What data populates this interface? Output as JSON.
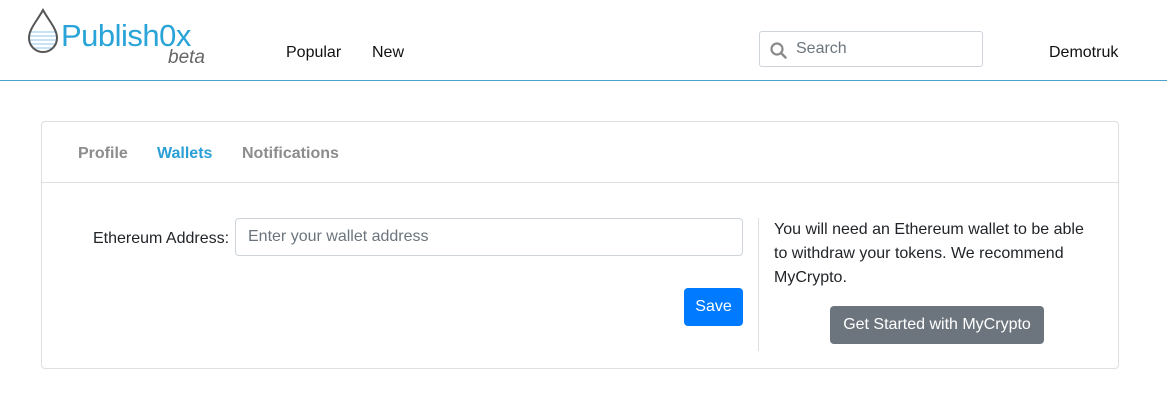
{
  "brand": {
    "name": "Publish0x",
    "badge": "beta",
    "logo_icon": "droplet-logo-icon",
    "accent_color": "#29a4d8"
  },
  "nav": {
    "links": [
      {
        "label": "Popular"
      },
      {
        "label": "New"
      }
    ]
  },
  "search": {
    "placeholder": "Search",
    "value": "",
    "icon": "search-icon"
  },
  "user": {
    "name": "Demotruk"
  },
  "tabs": [
    {
      "label": "Profile",
      "active": false
    },
    {
      "label": "Wallets",
      "active": true
    },
    {
      "label": "Notifications",
      "active": false
    }
  ],
  "wallet_form": {
    "label": "Ethereum Address:",
    "placeholder": "Enter your wallet address",
    "value": "",
    "save_label": "Save",
    "save_color": "#007bff"
  },
  "info": {
    "text": "You will need an Ethereum wallet to be able to withdraw your tokens. We recommend MyCrypto.",
    "button_label": "Get Started with MyCrypto",
    "button_color": "#6c757d"
  }
}
